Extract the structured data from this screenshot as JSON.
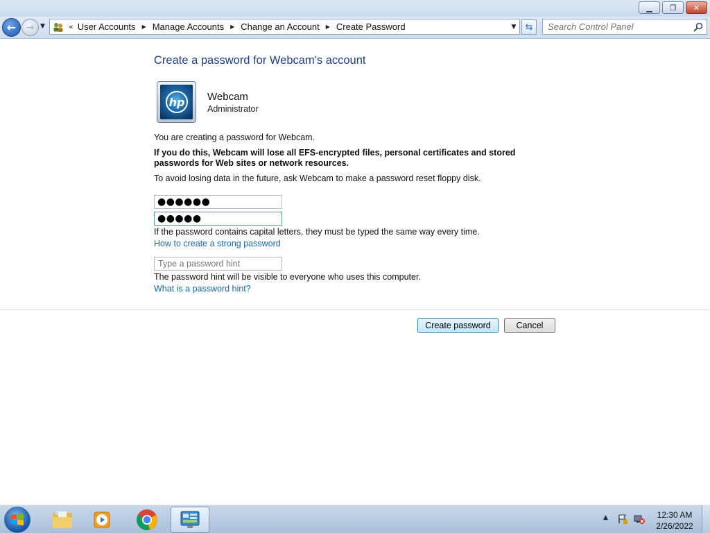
{
  "window": {
    "minimize_glyph": "▁",
    "maximize_glyph": "❐",
    "close_glyph": "✕"
  },
  "nav": {
    "breadcrumbs": [
      "User Accounts",
      "Manage Accounts",
      "Change an Account",
      "Create Password"
    ],
    "search_placeholder": "Search Control Panel"
  },
  "main": {
    "title": "Create a password for Webcam's account",
    "user": {
      "name": "Webcam",
      "role": "Administrator",
      "avatar_text": "hp"
    },
    "intro": "You are creating a password for Webcam.",
    "warning": "If you do this, Webcam will lose all EFS-encrypted files, personal certificates and stored passwords for Web sites or network resources.",
    "advice": "To avoid losing data in the future, ask Webcam to make a password reset floppy disk.",
    "new_password_mask": "●●●●●●",
    "confirm_password_mask": "●●●●●",
    "caps_note": "If the password contains capital letters, they must be typed the same way every time.",
    "strong_link": "How to create a strong password",
    "hint_placeholder": "Type a password hint",
    "hint_note": "The password hint will be visible to everyone who uses this computer.",
    "hint_link": "What is a password hint?",
    "create_button": "Create password",
    "cancel_button": "Cancel"
  },
  "taskbar": {
    "pinned": [
      "file-explorer-icon",
      "media-player-icon",
      "chrome-icon",
      "control-panel-icon"
    ],
    "time": "12:30 AM",
    "date": "2/26/2022"
  }
}
